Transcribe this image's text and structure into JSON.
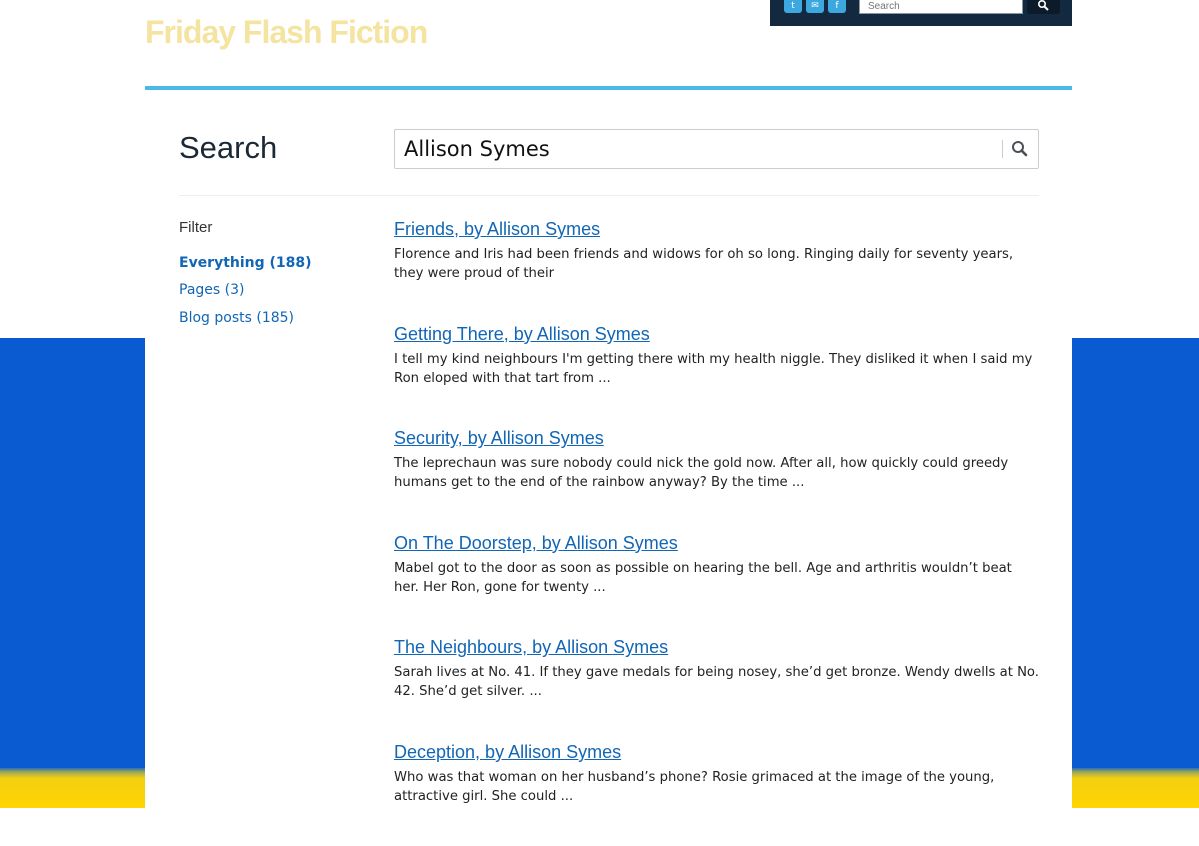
{
  "site": {
    "title": "Friday Flash Fiction"
  },
  "header": {
    "social": [
      {
        "name": "twitter-icon",
        "glyph": "t"
      },
      {
        "name": "email-icon",
        "glyph": "✉"
      },
      {
        "name": "facebook-icon",
        "glyph": "f"
      }
    ],
    "search_placeholder": "Search"
  },
  "search": {
    "heading": "Search",
    "query": "Allison Symes"
  },
  "filter": {
    "title": "Filter",
    "items": [
      {
        "label": "Everything (188)",
        "active": true
      },
      {
        "label": "Pages (3)",
        "active": false
      },
      {
        "label": "Blog posts (185)",
        "active": false
      }
    ]
  },
  "results": [
    {
      "title": "Friends, by Allison Symes",
      "excerpt": "Florence and Iris had been friends and widows for oh so long. Ringing daily for seventy years, they were proud of their"
    },
    {
      "title": "Getting There, by Allison Symes",
      "excerpt": "I tell my kind neighbours I'm getting there with my health niggle. They disliked it when I said my Ron eloped with that tart from ..."
    },
    {
      "title": "Security, by Allison Symes",
      "excerpt": "The leprechaun was sure nobody could nick the gold now. After all, how quickly could greedy humans get to the end of the rainbow anyway? By the time ..."
    },
    {
      "title": "On The Doorstep, by Allison Symes",
      "excerpt": "Mabel got to the door as soon as possible on hearing the bell. Age and arthritis wouldn’t beat her. Her Ron, gone for twenty ..."
    },
    {
      "title": "The Neighbours, by Allison Symes",
      "excerpt": "Sarah lives at No. 41. If they gave medals for being nosey, she’d get bronze. Wendy dwells at No. 42. She’d get silver. ..."
    },
    {
      "title": "Deception, by Allison Symes",
      "excerpt": "Who was that woman on her husband’s phone? Rosie grimaced at the image of the young, attractive girl. She could ..."
    }
  ]
}
